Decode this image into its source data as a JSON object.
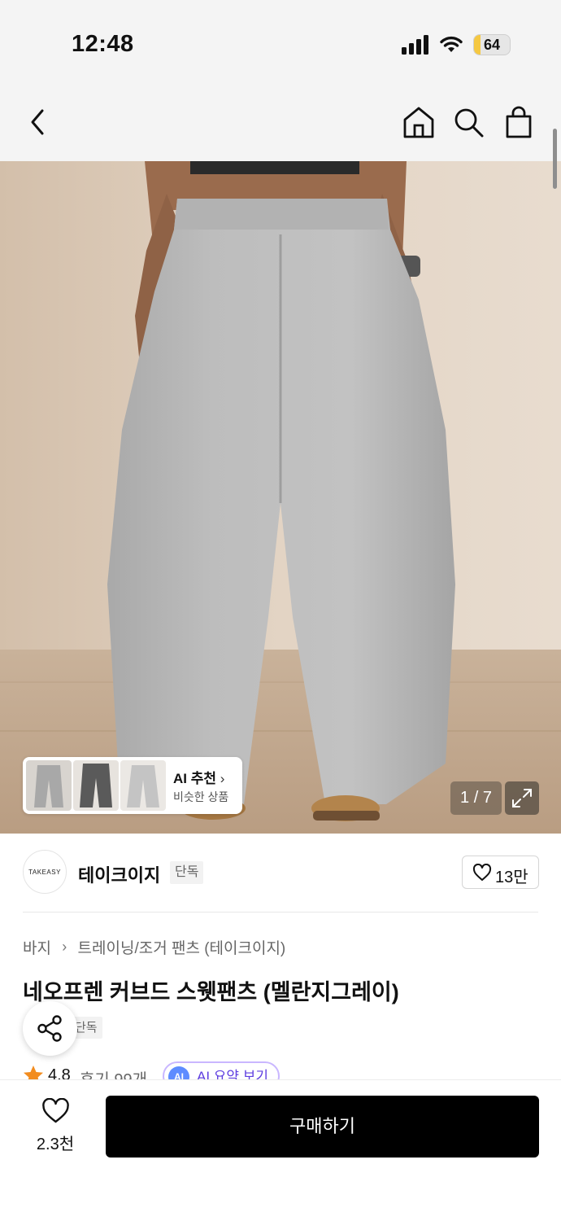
{
  "status_bar": {
    "time": "12:48",
    "battery_level": "64",
    "icons": [
      "signal-icon",
      "wifi-icon",
      "battery-icon"
    ]
  },
  "header": {
    "icons": [
      "back-arrow-icon",
      "home-icon",
      "search-icon",
      "shopping-bag-icon"
    ]
  },
  "gallery": {
    "ai_recommend": {
      "title": "AI 추천",
      "subtitle": "비슷한 상품"
    },
    "pager": "1 / 7"
  },
  "brand": {
    "logo_text": "TAKEASY",
    "name": "테이크이지",
    "tag": "단독",
    "likes": "13만"
  },
  "product": {
    "breadcrumb": [
      "바지",
      "트레이닝/조거 팬츠 (테이크이지)"
    ],
    "title": "네오프렌 커브드 스웻팬츠 (멜란지그레이)",
    "tag": "단독",
    "rating": "4.8",
    "reviews": "후기 99개",
    "ai_summary": "AI 요약 보기",
    "ai_badge": "AI"
  },
  "bottom_bar": {
    "wish_count": "2.3천",
    "buy_label": "구매하기"
  },
  "colors": {
    "accent_purple": "#5e3ee0",
    "star": "#f28c1f",
    "buy_button": "#000000"
  }
}
